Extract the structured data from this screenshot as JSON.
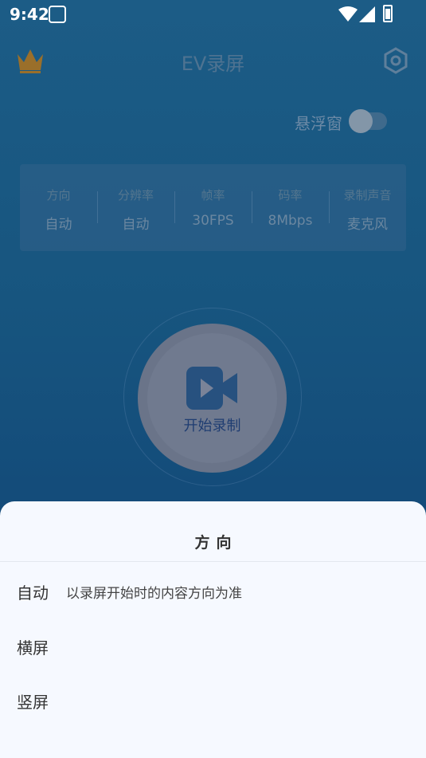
{
  "status_bar": {
    "time": "9:42"
  },
  "header": {
    "title": "EV录屏"
  },
  "float_window": {
    "label": "悬浮窗",
    "enabled": false
  },
  "settings_card": {
    "items": [
      {
        "label": "方向",
        "value": "自动"
      },
      {
        "label": "分辨率",
        "value": "自动"
      },
      {
        "label": "帧率",
        "value": "30FPS"
      },
      {
        "label": "码率",
        "value": "8Mbps"
      },
      {
        "label": "录制声音",
        "value": "麦克风"
      }
    ]
  },
  "record": {
    "label": "开始录制"
  },
  "sheet": {
    "title": "方向",
    "options": [
      {
        "label": "自动",
        "description": "以录屏开始时的内容方向为准"
      },
      {
        "label": "横屏"
      },
      {
        "label": "竖屏"
      }
    ]
  },
  "colors": {
    "background": "#17557f",
    "sheet": "#f6f9ff",
    "crown": "#b8852f"
  }
}
